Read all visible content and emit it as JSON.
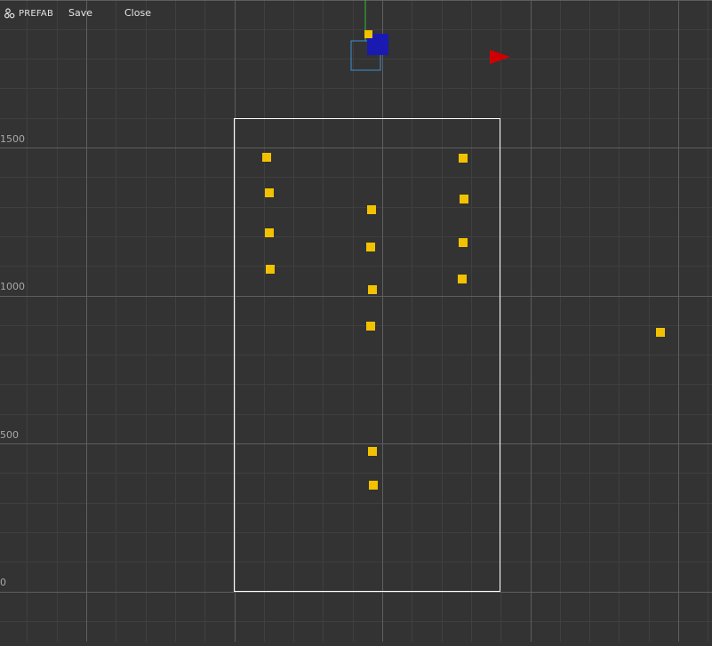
{
  "toolbar": {
    "mode_label": "PREFAB",
    "mode_icon": "prefab-icon",
    "save_label": "Save",
    "close_label": "Close"
  },
  "axis": {
    "y_labels": [
      "1500",
      "1000",
      "500",
      "0"
    ]
  },
  "colors": {
    "background": "#333333",
    "grid_minor": "#3f3f3f",
    "grid_major": "#5e5e5e",
    "bounds": "#ffffff",
    "marker": "#f2c200",
    "gizmo_x_arrow": "#d10000",
    "gizmo_y_axis": "#2fbf2f",
    "gizmo_z_handle": "#1a1ab3",
    "selection": "#3d8fd6"
  }
}
